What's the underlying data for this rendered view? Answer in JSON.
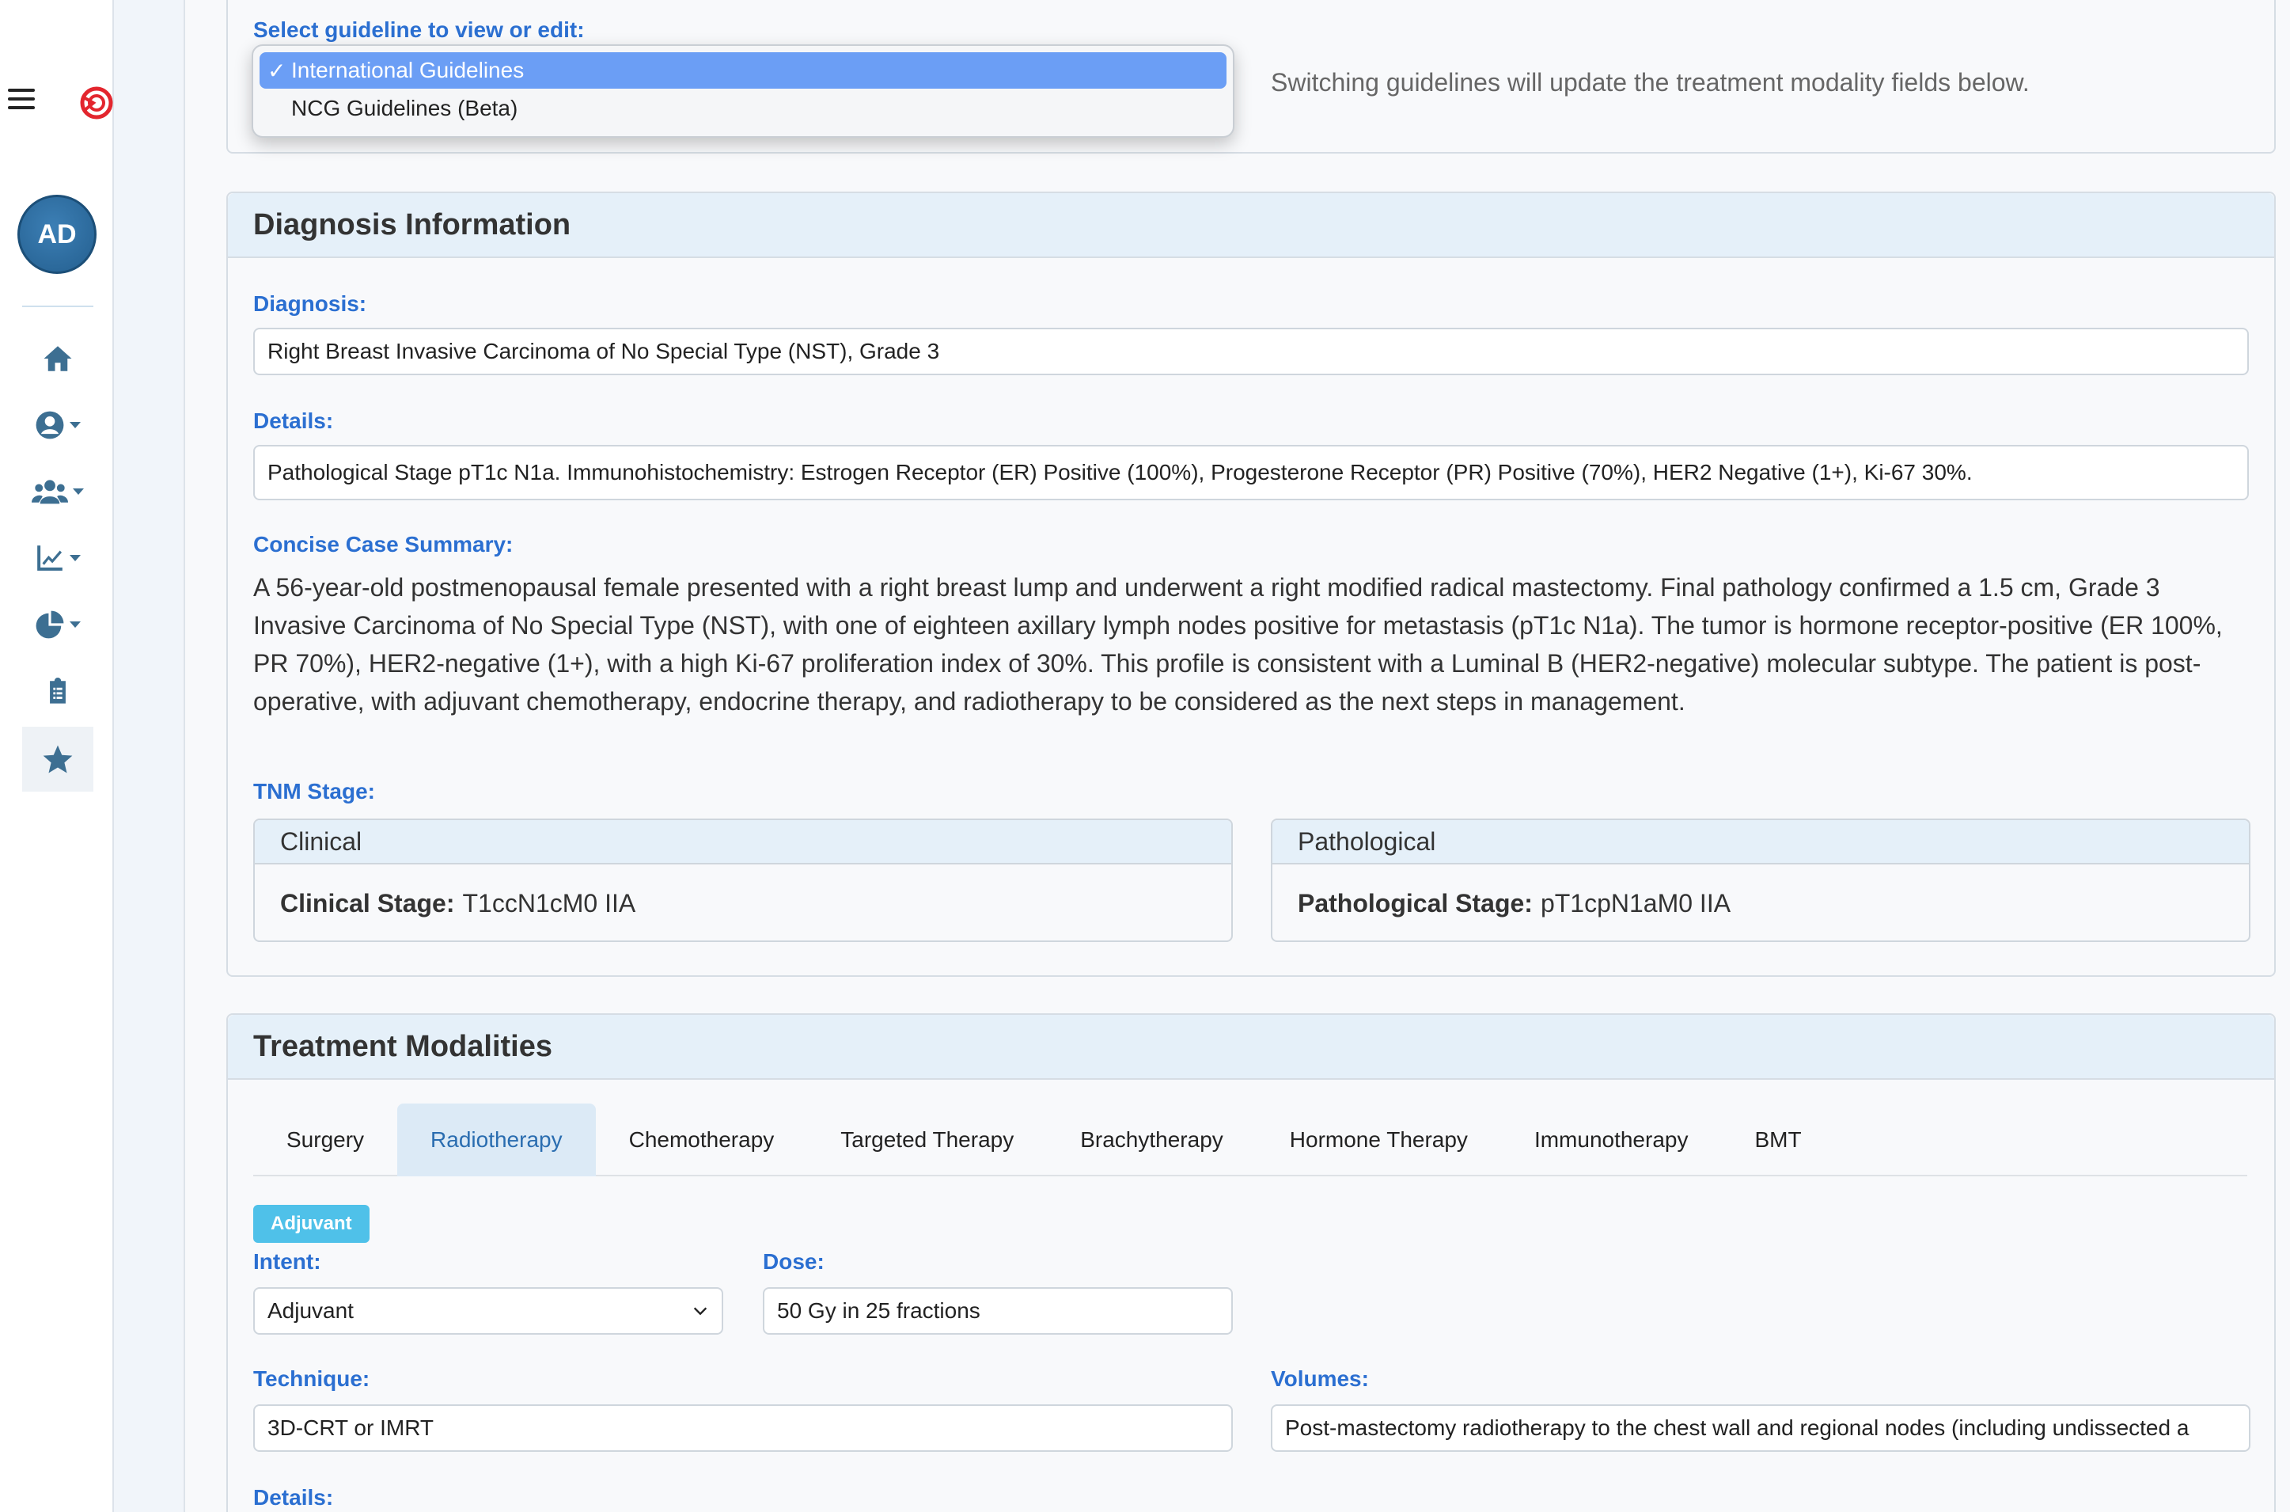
{
  "sidebar": {
    "avatar_initials": "AD",
    "items": [
      {
        "icon": "home-icon"
      },
      {
        "icon": "user-circle-icon",
        "has_caret": true
      },
      {
        "icon": "users-icon",
        "has_caret": true
      },
      {
        "icon": "chart-line-icon",
        "has_caret": true
      },
      {
        "icon": "pie-chart-icon",
        "has_caret": true
      },
      {
        "icon": "clipboard-list-icon"
      },
      {
        "icon": "star-icon",
        "active": true
      }
    ]
  },
  "guideline": {
    "label": "Select guideline to view or edit:",
    "options": [
      {
        "label": "International Guidelines",
        "selected": true,
        "check": "✓"
      },
      {
        "label": "NCG Guidelines (Beta)",
        "selected": false,
        "check": ""
      }
    ],
    "hint": "Switching guidelines will update the treatment modality fields below."
  },
  "diagnosis": {
    "title": "Diagnosis Information",
    "diagnosis_label": "Diagnosis:",
    "diagnosis_value": "Right Breast Invasive Carcinoma of No Special Type (NST), Grade 3",
    "details_label": "Details:",
    "details_value": "Pathological Stage pT1c N1a. Immunohistochemistry: Estrogen Receptor (ER) Positive (100%), Progesterone Receptor (PR) Positive (70%), HER2 Negative (1+), Ki-67 30%.",
    "summary_label": "Concise Case Summary:",
    "summary_text": "A 56-year-old postmenopausal female presented with a right breast lump and underwent a right modified radical mastectomy. Final pathology confirmed a 1.5 cm, Grade 3 Invasive Carcinoma of No Special Type (NST), with one of eighteen axillary lymph nodes positive for metastasis (pT1c N1a). The tumor is hormone receptor-positive (ER 100%, PR 70%), HER2-negative (1+), with a high Ki-67 proliferation index of 30%. This profile is consistent with a Luminal B (HER2-negative) molecular subtype. The patient is post-operative, with adjuvant chemotherapy, endocrine therapy, and radiotherapy to be considered as the next steps in management.",
    "tnm_label": "TNM Stage:",
    "clinical": {
      "header": "Clinical",
      "label": "Clinical Stage:",
      "value": "T1ccN1cM0 IIA"
    },
    "pathological": {
      "header": "Pathological",
      "label": "Pathological Stage:",
      "value": "pT1cpN1aM0 IIA"
    }
  },
  "treatment": {
    "title": "Treatment Modalities",
    "tabs": [
      "Surgery",
      "Radiotherapy",
      "Chemotherapy",
      "Targeted Therapy",
      "Brachytherapy",
      "Hormone Therapy",
      "Immunotherapy",
      "BMT"
    ],
    "active_tab": "Radiotherapy",
    "badge": "Adjuvant",
    "intent_label": "Intent:",
    "intent_value": "Adjuvant",
    "dose_label": "Dose:",
    "dose_value": "50 Gy in 25 fractions",
    "technique_label": "Technique:",
    "technique_value": "3D-CRT or IMRT",
    "volumes_label": "Volumes:",
    "volumes_value": "Post-mastectomy radiotherapy to the chest wall and regional nodes (including undissected a",
    "details_label": "Details:"
  },
  "colors": {
    "accent_label": "#2b6fd1",
    "header_bg": "#e5f0f9",
    "badge": "#4fc1e9",
    "dropdown_selected": "#6b9ef5",
    "icon": "#3d6f92"
  }
}
